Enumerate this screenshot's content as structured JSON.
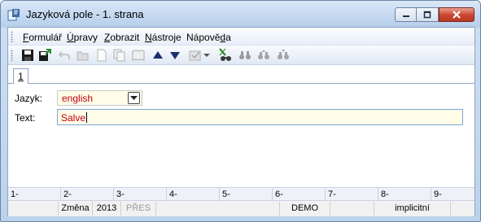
{
  "window": {
    "title": "Jazyková pole - 1. strana"
  },
  "menu": [
    {
      "label": "Formulář"
    },
    {
      "label": "Úpravy"
    },
    {
      "label": "Zobrazit"
    },
    {
      "label": "Nástroje"
    },
    {
      "label": "Nápověda"
    }
  ],
  "tabs": [
    {
      "label": "1"
    }
  ],
  "form": {
    "language_label": "Jazyk:",
    "language_value": "english",
    "text_label": "Text:",
    "text_value": "Salve"
  },
  "status_row1": [
    "1-",
    "2-",
    "3-",
    "4-",
    "5-",
    "6-",
    "7-",
    "8-",
    "9-"
  ],
  "status_row2": {
    "mode": "Změna",
    "year": "2013",
    "insert": "PŘES",
    "database": "DEMO",
    "default": "implicitní"
  },
  "colors": {
    "value_text": "#c0000f",
    "input_bg": "#fffde8",
    "chrome": "#bcd2ec"
  }
}
